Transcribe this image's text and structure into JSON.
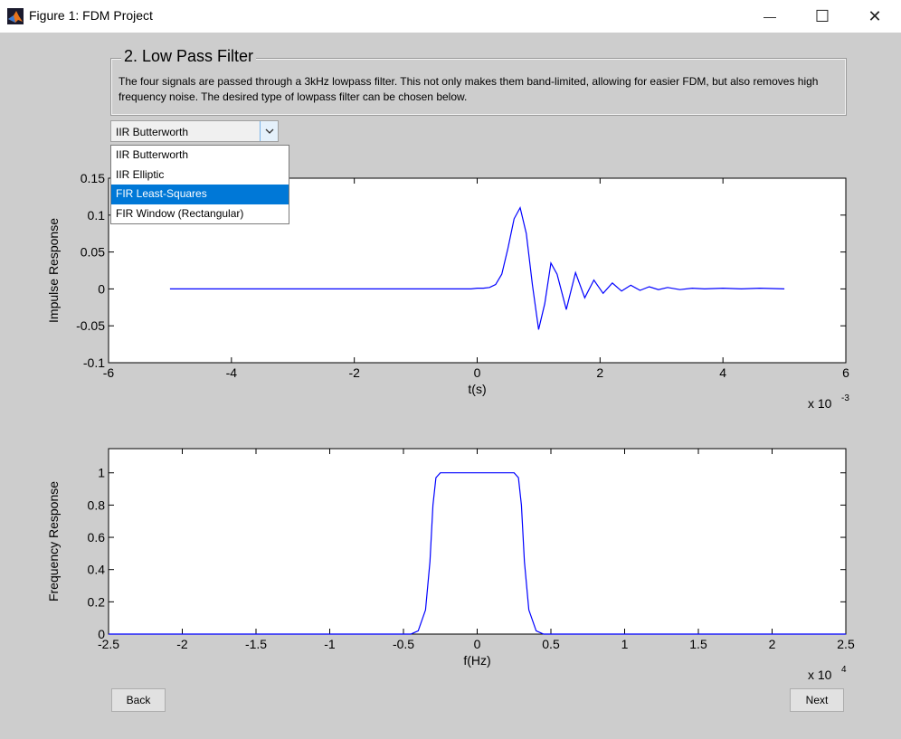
{
  "window": {
    "title": "Figure 1: FDM Project",
    "minimize_glyph": "—",
    "maximize_glyph": "☐",
    "close_glyph": "✕"
  },
  "panel": {
    "title": "2. Low Pass Filter",
    "text": "The four signals are passed through a 3kHz lowpass filter. This not only makes them band-limited, allowing for easier FDM, but also removes high frequency noise. The desired type of lowpass filter can be chosen below."
  },
  "filter_select": {
    "value": "IIR Butterworth",
    "options": [
      "IIR Butterworth",
      "IIR Elliptic",
      "FIR Least-Squares",
      "FIR Window (Rectangular)"
    ],
    "highlighted": "FIR Least-Squares"
  },
  "buttons": {
    "back": "Back",
    "next": "Next"
  },
  "colors": {
    "line": "#0000ff",
    "highlight": "#0078d7",
    "background": "#cdcdcd"
  },
  "chart_data": [
    {
      "type": "line",
      "xlabel": "t(s)",
      "ylabel": "Impulse Response",
      "xlim": [
        -6,
        6
      ],
      "ylim": [
        -0.1,
        0.15
      ],
      "x_multiplier_label": {
        "base": "x 10",
        "exponent": "-3"
      },
      "xticks": [
        -6,
        -4,
        -2,
        0,
        2,
        4,
        6
      ],
      "xtick_labels": [
        "-6",
        "-4",
        "-2",
        "0",
        "2",
        "4",
        "6"
      ],
      "yticks": [
        -0.1,
        -0.05,
        0,
        0.05,
        0.1,
        0.15
      ],
      "ytick_labels": [
        "-0.1",
        "-0.05",
        "0",
        "0.05",
        "0.1",
        "0.15"
      ],
      "series": [
        {
          "color": "#0000ff",
          "x": [
            -5,
            -0.1,
            0,
            0.1,
            0.2,
            0.3,
            0.4,
            0.5,
            0.6,
            0.7,
            0.8,
            0.9,
            1.0,
            1.1,
            1.2,
            1.3,
            1.45,
            1.6,
            1.75,
            1.9,
            2.05,
            2.2,
            2.35,
            2.5,
            2.65,
            2.8,
            2.95,
            3.1,
            3.3,
            3.5,
            3.7,
            4.0,
            4.3,
            4.6,
            5.0
          ],
          "y": [
            0,
            0,
            0.001,
            0.001,
            0.002,
            0.006,
            0.02,
            0.055,
            0.095,
            0.11,
            0.075,
            0.005,
            -0.055,
            -0.02,
            0.035,
            0.02,
            -0.028,
            0.022,
            -0.012,
            0.012,
            -0.006,
            0.008,
            -0.003,
            0.005,
            -0.002,
            0.003,
            -0.001,
            0.002,
            -0.001,
            0.001,
            0,
            0.001,
            0,
            0.001,
            0
          ]
        }
      ]
    },
    {
      "type": "line",
      "xlabel": "f(Hz)",
      "ylabel": "Frequency Response",
      "xlim": [
        -2.5,
        2.5
      ],
      "ylim": [
        0,
        1.15
      ],
      "x_multiplier_label": {
        "base": "x 10",
        "exponent": "4"
      },
      "xticks": [
        -2.5,
        -2,
        -1.5,
        -1,
        -0.5,
        0,
        0.5,
        1,
        1.5,
        2,
        2.5
      ],
      "xtick_labels": [
        "-2.5",
        "-2",
        "-1.5",
        "-1",
        "-0.5",
        "0",
        "0.5",
        "1",
        "1.5",
        "2",
        "2.5"
      ],
      "yticks": [
        0,
        0.2,
        0.4,
        0.6,
        0.8,
        1
      ],
      "ytick_labels": [
        "0",
        "0.2",
        "0.4",
        "0.6",
        "0.8",
        "1"
      ],
      "series": [
        {
          "color": "#0000ff",
          "x": [
            -2.5,
            -0.45,
            -0.4,
            -0.35,
            -0.32,
            -0.3,
            -0.28,
            -0.25,
            0.25,
            0.28,
            0.3,
            0.32,
            0.35,
            0.4,
            0.45,
            2.5
          ],
          "y": [
            0,
            0,
            0.02,
            0.15,
            0.45,
            0.8,
            0.97,
            1,
            1,
            0.97,
            0.8,
            0.45,
            0.15,
            0.02,
            0,
            0
          ]
        }
      ]
    }
  ]
}
